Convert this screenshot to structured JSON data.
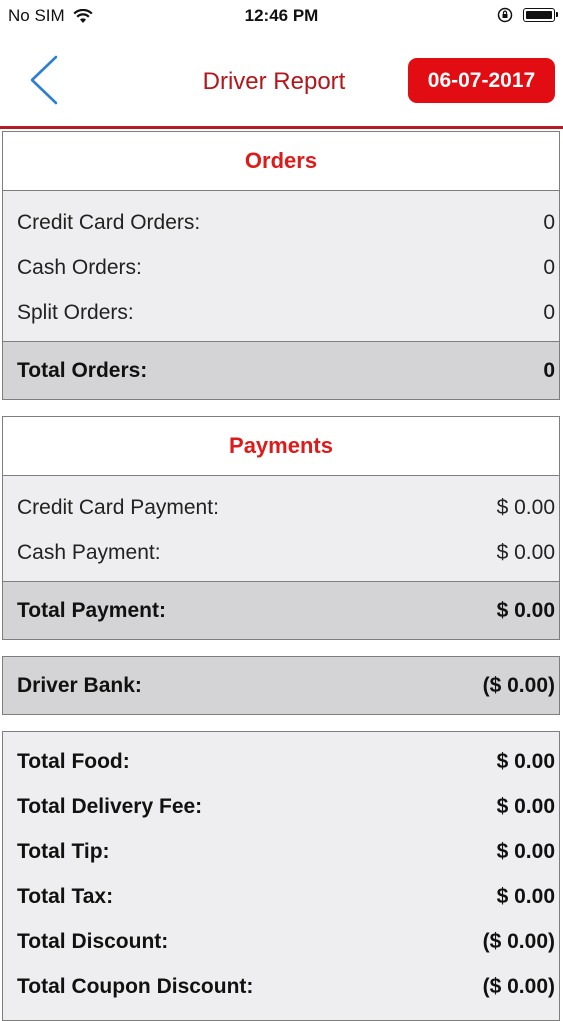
{
  "status": {
    "carrier": "No SIM",
    "time": "12:46 PM"
  },
  "nav": {
    "title": "Driver Report",
    "date": "06-07-2017"
  },
  "orders": {
    "header": "Orders",
    "items": [
      {
        "label": "Credit Card Orders:",
        "value": "0"
      },
      {
        "label": "Cash Orders:",
        "value": "0"
      },
      {
        "label": "Split Orders:",
        "value": "0"
      }
    ],
    "total": {
      "label": "Total Orders:",
      "value": "0"
    }
  },
  "payments": {
    "header": "Payments",
    "items": [
      {
        "label": "Credit Card Payment:",
        "value": "$ 0.00"
      },
      {
        "label": "Cash Payment:",
        "value": "$ 0.00"
      }
    ],
    "total": {
      "label": "Total Payment:",
      "value": "$ 0.00"
    }
  },
  "bank": {
    "label": "Driver Bank:",
    "value": "($ 0.00)"
  },
  "totals": [
    {
      "label": "Total Food:",
      "value": "$ 0.00"
    },
    {
      "label": "Total Delivery Fee:",
      "value": "$ 0.00"
    },
    {
      "label": "Total Tip:",
      "value": "$ 0.00"
    },
    {
      "label": "Total Tax:",
      "value": "$ 0.00"
    },
    {
      "label": "Total Discount:",
      "value": "($ 0.00)"
    },
    {
      "label": "Total Coupon Discount:",
      "value": "($ 0.00)"
    }
  ]
}
